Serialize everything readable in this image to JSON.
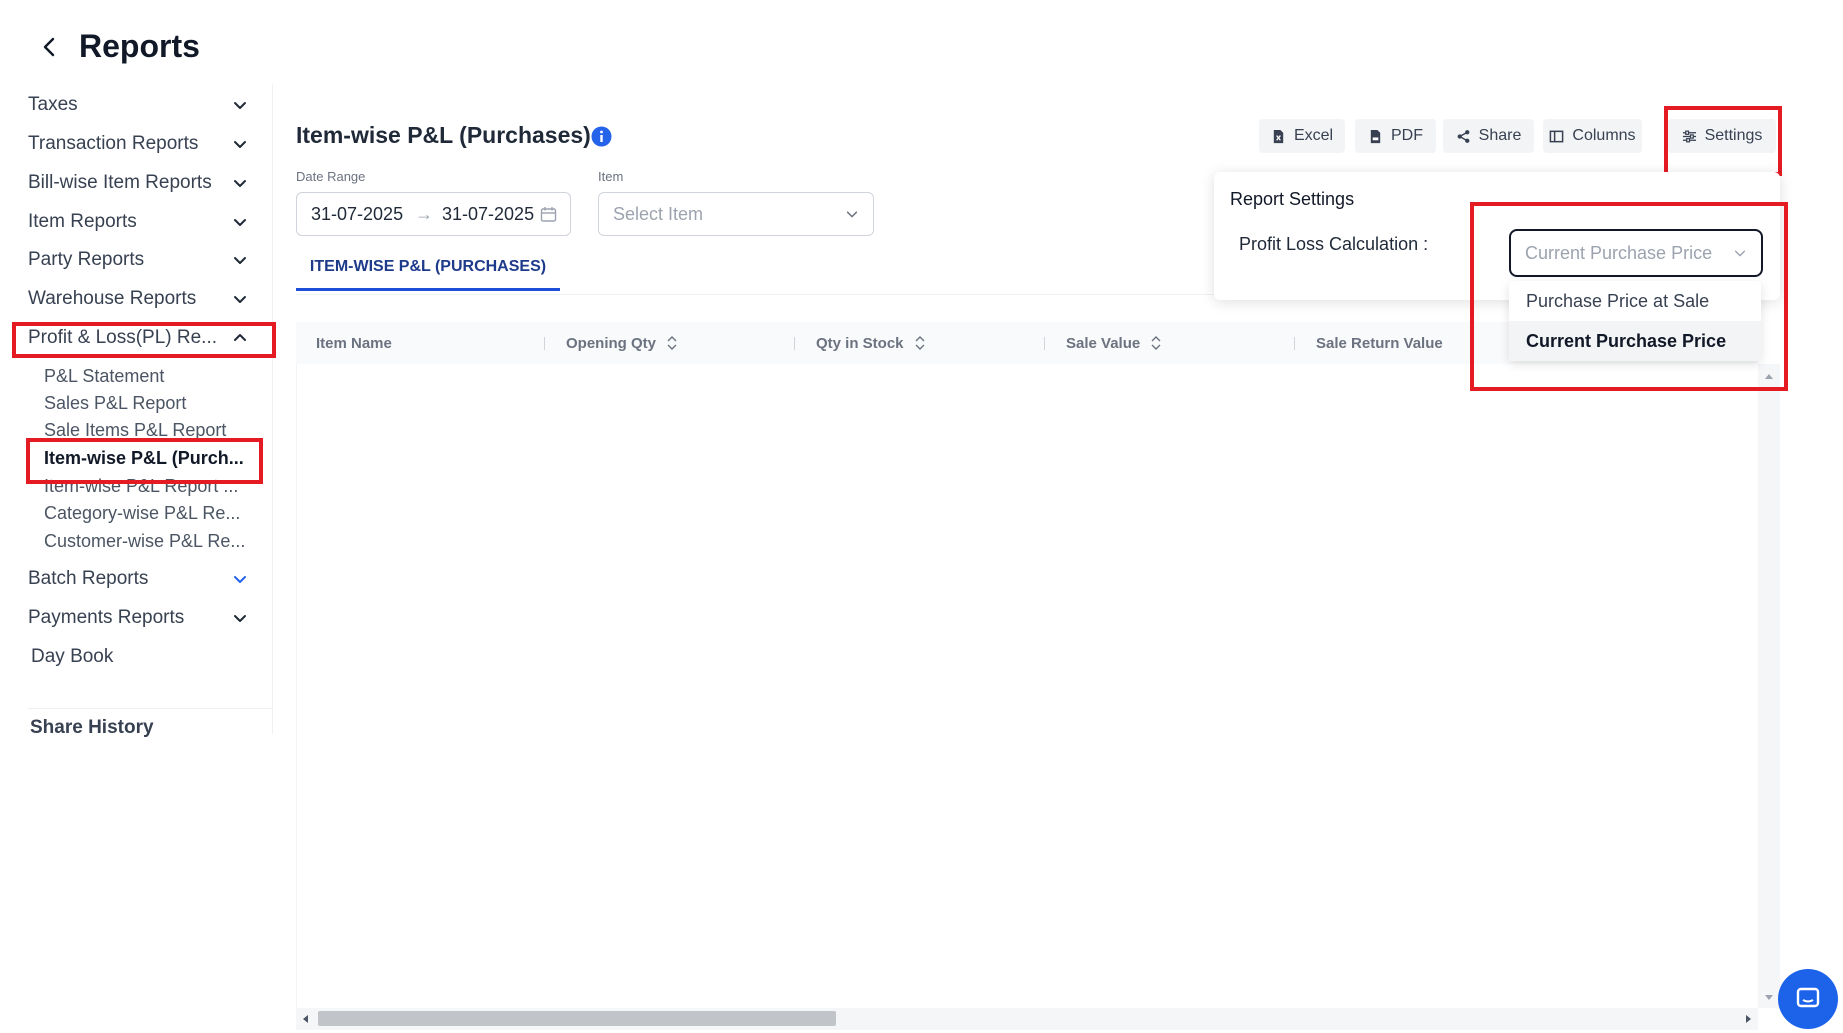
{
  "header": {
    "title": "Reports"
  },
  "sidebar": {
    "items": [
      {
        "label": "Taxes"
      },
      {
        "label": "Transaction Reports"
      },
      {
        "label": "Bill-wise Item Reports"
      },
      {
        "label": "Item Reports"
      },
      {
        "label": "Party Reports"
      },
      {
        "label": "Warehouse Reports"
      },
      {
        "label": "Profit & Loss(PL) Re..."
      },
      {
        "label": "Batch Reports"
      },
      {
        "label": "Payments Reports"
      },
      {
        "label": "Day Book"
      }
    ],
    "pl_subitems": [
      {
        "label": "P&L Statement"
      },
      {
        "label": "Sales P&L Report"
      },
      {
        "label": "Sale Items P&L Report"
      },
      {
        "label": "Item-wise P&L (Purch..."
      },
      {
        "label": "Item-wise P&L Report ..."
      },
      {
        "label": "Category-wise P&L Re..."
      },
      {
        "label": "Customer-wise P&L Re..."
      }
    ],
    "share_history": "Share History"
  },
  "main": {
    "title": "Item-wise P&L (Purchases)",
    "toolbar": {
      "excel": "Excel",
      "pdf": "PDF",
      "share": "Share",
      "columns": "Columns",
      "settings": "Settings"
    },
    "filters": {
      "date_label": "Date Range",
      "date_from": "31-07-2025",
      "date_to": "31-07-2025",
      "item_label": "Item",
      "item_placeholder": "Select Item"
    },
    "tab": "ITEM-WISE P&L (PURCHASES)",
    "columns": [
      "Item Name",
      "Opening Qty",
      "Qty in Stock",
      "Sale Value",
      "Sale Return Value"
    ]
  },
  "settings_popup": {
    "title": "Report Settings",
    "label": "Profit Loss Calculation :",
    "selected": "Current Purchase Price",
    "options": [
      "Purchase Price at Sale",
      "Current Purchase Price"
    ]
  },
  "colors": {
    "accent": "#1d4ed8",
    "highlight": "#e51b24",
    "chat": "#1d63ea"
  }
}
